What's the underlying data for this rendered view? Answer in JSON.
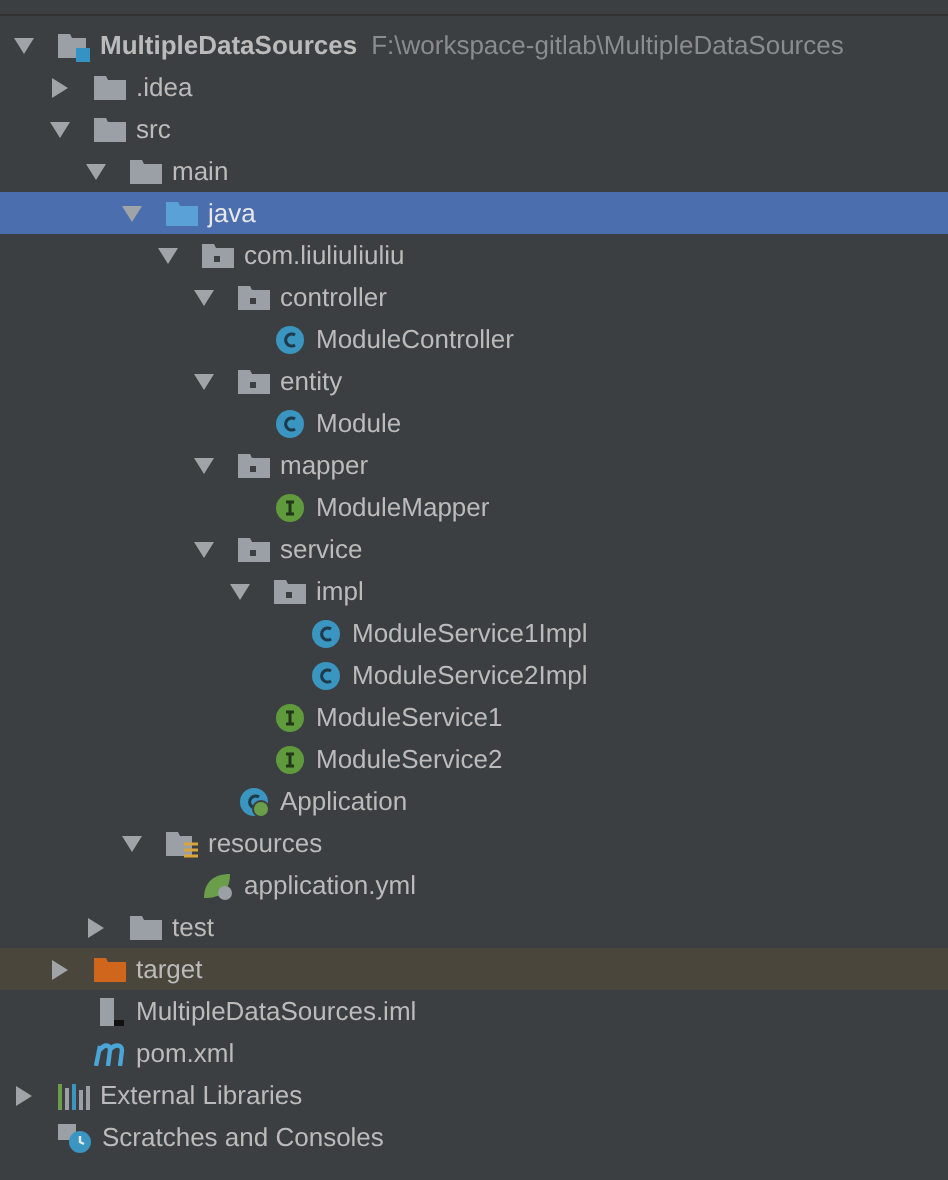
{
  "tree": [
    {
      "label": "MultipleDataSources",
      "path": "F:\\workspace-gitlab\\MultipleDataSources",
      "kind": "module",
      "expanded": true,
      "selected": false,
      "highlighted": false,
      "children": [
        {
          "label": ".idea",
          "kind": "folder",
          "expanded": false,
          "selected": false,
          "highlighted": false
        },
        {
          "label": "src",
          "kind": "folder",
          "expanded": true,
          "selected": false,
          "highlighted": false,
          "children": [
            {
              "label": "main",
              "kind": "folder",
              "expanded": true,
              "selected": false,
              "highlighted": false,
              "children": [
                {
                  "label": "java",
                  "kind": "source-folder",
                  "expanded": true,
                  "selected": true,
                  "highlighted": false,
                  "children": [
                    {
                      "label": "com.liuliuliuliu",
                      "kind": "package",
                      "expanded": true,
                      "selected": false,
                      "highlighted": false,
                      "children": [
                        {
                          "label": "controller",
                          "kind": "package",
                          "expanded": true,
                          "selected": false,
                          "highlighted": false,
                          "children": [
                            {
                              "label": "ModuleController",
                              "kind": "class",
                              "selected": false,
                              "highlighted": false
                            }
                          ]
                        },
                        {
                          "label": "entity",
                          "kind": "package",
                          "expanded": true,
                          "selected": false,
                          "highlighted": false,
                          "children": [
                            {
                              "label": "Module",
                              "kind": "class",
                              "selected": false,
                              "highlighted": false
                            }
                          ]
                        },
                        {
                          "label": "mapper",
                          "kind": "package",
                          "expanded": true,
                          "selected": false,
                          "highlighted": false,
                          "children": [
                            {
                              "label": "ModuleMapper",
                              "kind": "interface",
                              "selected": false,
                              "highlighted": false
                            }
                          ]
                        },
                        {
                          "label": "service",
                          "kind": "package",
                          "expanded": true,
                          "selected": false,
                          "highlighted": false,
                          "children": [
                            {
                              "label": "impl",
                              "kind": "package",
                              "expanded": true,
                              "selected": false,
                              "highlighted": false,
                              "children": [
                                {
                                  "label": "ModuleService1Impl",
                                  "kind": "class",
                                  "selected": false,
                                  "highlighted": false
                                },
                                {
                                  "label": "ModuleService2Impl",
                                  "kind": "class",
                                  "selected": false,
                                  "highlighted": false
                                }
                              ]
                            },
                            {
                              "label": "ModuleService1",
                              "kind": "interface",
                              "selected": false,
                              "highlighted": false
                            },
                            {
                              "label": "ModuleService2",
                              "kind": "interface",
                              "selected": false,
                              "highlighted": false
                            }
                          ]
                        },
                        {
                          "label": "Application",
                          "kind": "spring-class",
                          "selected": false,
                          "highlighted": false
                        }
                      ]
                    }
                  ]
                },
                {
                  "label": "resources",
                  "kind": "resources",
                  "expanded": true,
                  "selected": false,
                  "highlighted": false,
                  "children": [
                    {
                      "label": "application.yml",
                      "kind": "spring-config",
                      "selected": false,
                      "highlighted": false
                    }
                  ]
                }
              ]
            },
            {
              "label": "test",
              "kind": "folder",
              "expanded": false,
              "selected": false,
              "highlighted": false
            }
          ]
        },
        {
          "label": "target",
          "kind": "excluded-folder",
          "expanded": false,
          "selected": false,
          "highlighted": true
        },
        {
          "label": "MultipleDataSources.iml",
          "kind": "iml",
          "selected": false,
          "highlighted": false
        },
        {
          "label": "pom.xml",
          "kind": "maven",
          "selected": false,
          "highlighted": false
        }
      ]
    },
    {
      "label": "External Libraries",
      "kind": "libraries",
      "expanded": false,
      "selected": false,
      "highlighted": false
    },
    {
      "label": "Scratches and Consoles",
      "kind": "scratches",
      "selected": false,
      "highlighted": false
    }
  ]
}
